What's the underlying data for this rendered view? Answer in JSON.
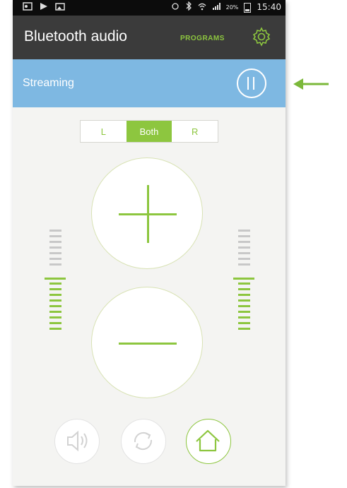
{
  "status_bar": {
    "battery_percent": "20%",
    "time": "15:40"
  },
  "app_bar": {
    "title": "Bluetooth audio",
    "programs_label": "PROGRAMS",
    "settings_icon": "gear-icon"
  },
  "stream_bar": {
    "label": "Streaming",
    "pause_icon": "pause-icon"
  },
  "ear_selector": {
    "options": [
      "L",
      "Both",
      "R"
    ],
    "selected": "Both"
  },
  "volume": {
    "up_icon": "plus-icon",
    "down_icon": "minus-icon",
    "left_level": 0.6,
    "right_level": 0.6
  },
  "bottom_nav": {
    "items": [
      {
        "icon": "speaker-icon",
        "active": false
      },
      {
        "icon": "sync-icon",
        "active": false
      },
      {
        "icon": "home-icon",
        "active": true
      }
    ]
  },
  "colors": {
    "accent": "#8dc63f",
    "app_bar": "#3b3b3b",
    "stream_bar": "#7eb8e2",
    "background": "#f4f4f2"
  }
}
